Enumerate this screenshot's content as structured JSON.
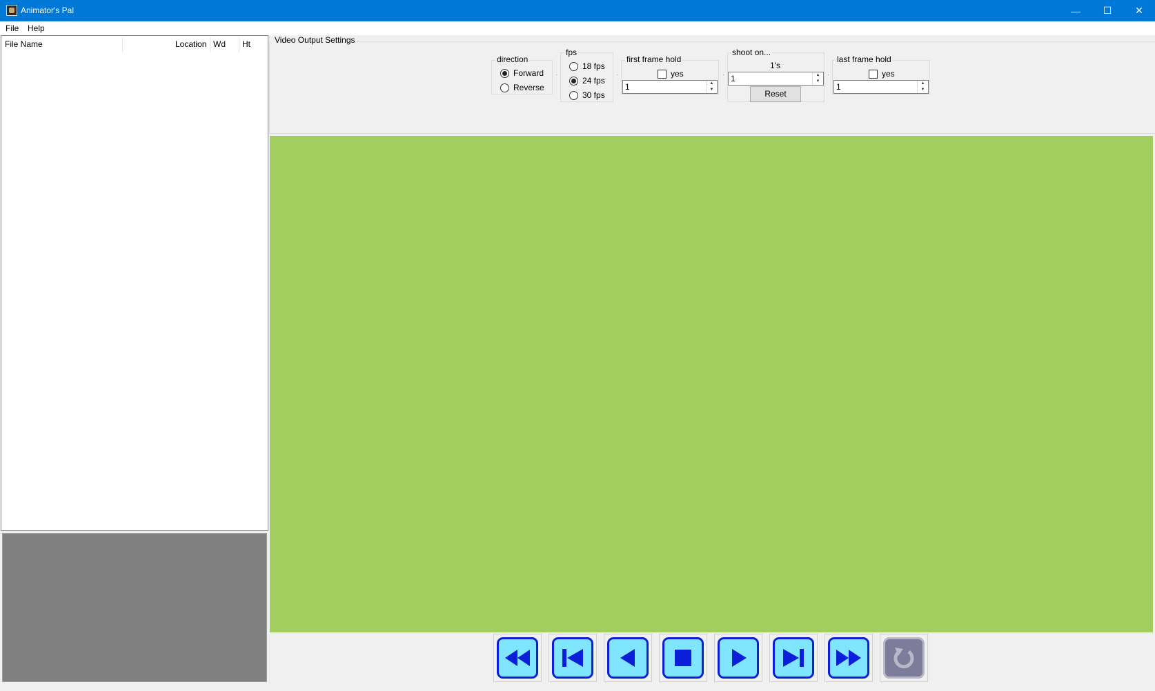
{
  "window": {
    "title": "Animator's Pal",
    "min": "—",
    "max": "☐",
    "close": "✕"
  },
  "menu": [
    "File",
    "Help"
  ],
  "filelist": {
    "columns": [
      "File Name",
      "Location",
      "Wd",
      "Ht"
    ]
  },
  "settings": {
    "legend": "Video Output Settings",
    "direction": {
      "label": "direction",
      "options": [
        "Forward",
        "Reverse"
      ],
      "selected": "Forward"
    },
    "fps": {
      "label": "fps",
      "options": [
        "18 fps",
        "24 fps",
        "30 fps"
      ],
      "selected": "24 fps"
    },
    "first_frame_hold": {
      "label": "first frame hold",
      "check_label": "yes",
      "checked": false,
      "value": "1"
    },
    "shoot_on": {
      "label": "shoot on...",
      "caption": "1's",
      "value": "1",
      "reset": "Reset"
    },
    "last_frame_hold": {
      "label": "last frame hold",
      "check_label": "yes",
      "checked": false,
      "value": "1"
    }
  },
  "canvas": {
    "color": "#a2cd5f"
  },
  "transport": [
    {
      "name": "rewind",
      "enabled": true
    },
    {
      "name": "first-frame",
      "enabled": true
    },
    {
      "name": "step-back",
      "enabled": true
    },
    {
      "name": "stop",
      "enabled": true
    },
    {
      "name": "play",
      "enabled": true
    },
    {
      "name": "last-frame",
      "enabled": true
    },
    {
      "name": "fast-forward",
      "enabled": true
    },
    {
      "name": "loop",
      "enabled": false
    }
  ]
}
